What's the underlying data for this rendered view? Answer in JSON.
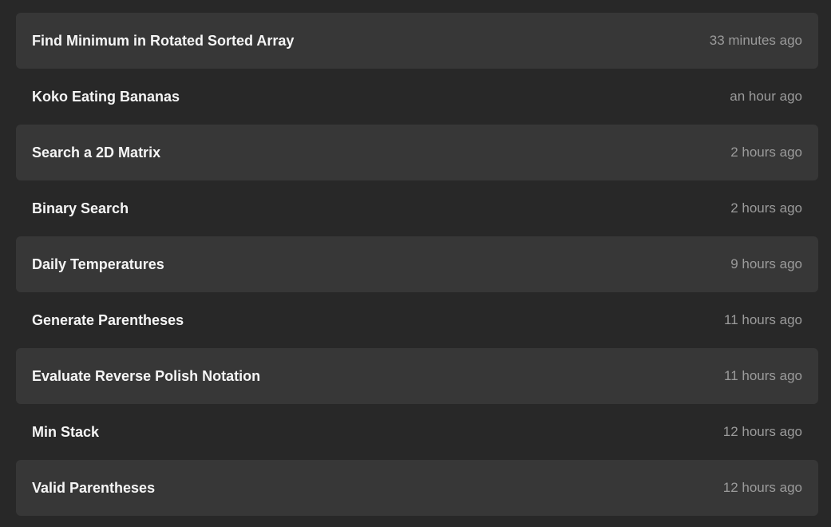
{
  "submissions": [
    {
      "title": "Find Minimum in Rotated Sorted Array",
      "time": "33 minutes ago"
    },
    {
      "title": "Koko Eating Bananas",
      "time": "an hour ago"
    },
    {
      "title": "Search a 2D Matrix",
      "time": "2 hours ago"
    },
    {
      "title": "Binary Search",
      "time": "2 hours ago"
    },
    {
      "title": "Daily Temperatures",
      "time": "9 hours ago"
    },
    {
      "title": "Generate Parentheses",
      "time": "11 hours ago"
    },
    {
      "title": "Evaluate Reverse Polish Notation",
      "time": "11 hours ago"
    },
    {
      "title": "Min Stack",
      "time": "12 hours ago"
    },
    {
      "title": "Valid Parentheses",
      "time": "12 hours ago"
    }
  ],
  "colors": {
    "background": "#282828",
    "row_shaded": "#373737",
    "title_text": "#f5f5f5",
    "time_text": "#9b9b9b"
  }
}
